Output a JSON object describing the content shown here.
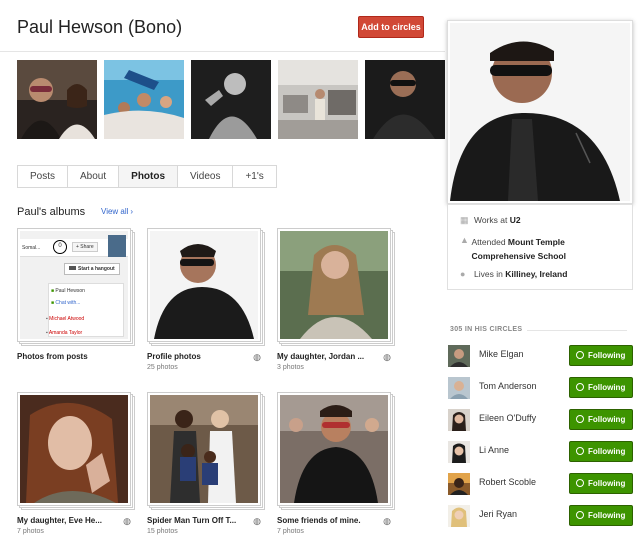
{
  "header": {
    "name": "Paul Hewson (Bono)",
    "add_button": "Add to circles"
  },
  "tabs": [
    "Posts",
    "About",
    "Photos",
    "Videos",
    "+1's"
  ],
  "active_tab": "Photos",
  "albums": {
    "title": "Paul's albums",
    "view_all": "View all",
    "items": [
      {
        "title": "Photos from posts",
        "count": ""
      },
      {
        "title": "Profile photos",
        "count": "25 photos"
      },
      {
        "title": "My daughter, Jordan ...",
        "count": "3 photos"
      },
      {
        "title": "My daughter, Eve He...",
        "count": "7 photos"
      },
      {
        "title": "Spider Man Turn Off T...",
        "count": "15 photos"
      },
      {
        "title": "Some friends of mine.",
        "count": "7 photos"
      }
    ],
    "hangout_thumb": {
      "count": "0",
      "share": "+ Share",
      "start_hangout": "Start a hangout",
      "names": [
        "Paul Hewson",
        "Chat with...",
        "Michael Atwood",
        "Amanda Taylor"
      ],
      "partial": "Somal..."
    }
  },
  "info": {
    "works_label": "Works at",
    "works_value": "U2",
    "attended_label": "Attended",
    "attended_value": "Mount Temple Comprehensive School",
    "lives_label": "Lives in",
    "lives_value": "Killiney, Ireland"
  },
  "circles": {
    "title": "305 IN HIS CIRCLES",
    "follow_label": "Following",
    "people": [
      "Mike Elgan",
      "Tom Anderson",
      "Eileen O'Duffy",
      "Li Anne",
      "Robert Scoble",
      "Jeri Ryan"
    ]
  }
}
